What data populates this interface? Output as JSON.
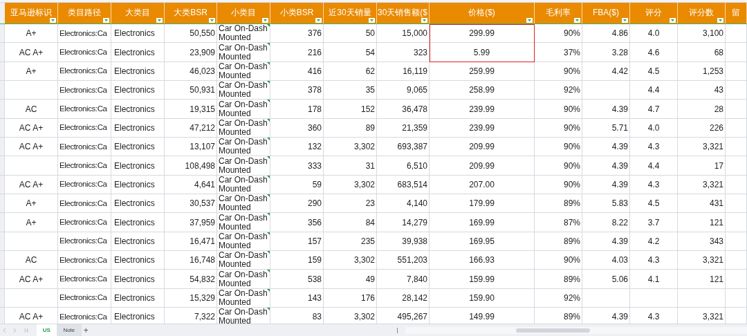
{
  "table": {
    "columns": [
      "亚马逊标识",
      "类目路径",
      "大类目",
      "大类BSR",
      "小类目",
      "小类BSR",
      "近30天销量",
      "30天销售额($",
      "价格($)",
      "毛利率",
      "FBA($)",
      "评分",
      "评分数",
      "留"
    ],
    "rows": [
      {
        "cells": [
          "A+",
          "Electronics:Ca",
          "Electronics",
          "50,550",
          "Car On-Dash Mounted",
          "376",
          "50",
          "15,000",
          "299.99",
          "90%",
          "4.86",
          "4.0",
          "3,100"
        ],
        "note_marker": true,
        "price_highlighted": true
      },
      {
        "cells": [
          "AC A+",
          "Electronics:Ca",
          "Electronics",
          "23,909",
          "Car On-Dash Mounted",
          "216",
          "54",
          "323",
          "5.99",
          "37%",
          "3.28",
          "4.6",
          "68"
        ],
        "note_marker": true,
        "price_highlighted": true
      },
      {
        "cells": [
          "A+",
          "Electronics:Ca",
          "Electronics",
          "46,023",
          "Car On-Dash Mounted",
          "416",
          "62",
          "16,119",
          "259.99",
          "90%",
          "4.42",
          "4.5",
          "1,253"
        ],
        "note_marker": true,
        "price_highlighted": false
      },
      {
        "cells": [
          "",
          "Electronics:Ca",
          "Electronics",
          "50,931",
          "Car On-Dash Mounted",
          "378",
          "35",
          "9,065",
          "258.99",
          "92%",
          "",
          "4.4",
          "43"
        ],
        "note_marker": true,
        "price_highlighted": false
      },
      {
        "cells": [
          "AC",
          "Electronics:Ca",
          "Electronics",
          "19,315",
          "Car On-Dash Mounted",
          "178",
          "152",
          "36,478",
          "239.99",
          "90%",
          "4.39",
          "4.7",
          "28"
        ],
        "note_marker": true,
        "price_highlighted": false
      },
      {
        "cells": [
          "AC A+",
          "Electronics:Ca",
          "Electronics",
          "47,212",
          "Car On-Dash Mounted",
          "360",
          "89",
          "21,359",
          "239.99",
          "90%",
          "5.71",
          "4.0",
          "226"
        ],
        "note_marker": true,
        "price_highlighted": false
      },
      {
        "cells": [
          "AC A+",
          "Electronics:Ca",
          "Electronics",
          "13,107",
          "Car On-Dash Mounted",
          "132",
          "3,302",
          "693,387",
          "209.99",
          "90%",
          "4.39",
          "4.3",
          "3,321"
        ],
        "note_marker": true,
        "price_highlighted": false
      },
      {
        "cells": [
          "",
          "Electronics:Ca",
          "Electronics",
          "108,498",
          "Car On-Dash Mounted",
          "333",
          "31",
          "6,510",
          "209.99",
          "90%",
          "4.39",
          "4.4",
          "17"
        ],
        "note_marker": true,
        "price_highlighted": false
      },
      {
        "cells": [
          "AC A+",
          "Electronics:Ca",
          "Electronics",
          "4,641",
          "Car On-Dash Mounted",
          "59",
          "3,302",
          "683,514",
          "207.00",
          "90%",
          "4.39",
          "4.3",
          "3,321"
        ],
        "note_marker": true,
        "price_highlighted": false
      },
      {
        "cells": [
          "A+",
          "Electronics:Ca",
          "Electronics",
          "30,537",
          "Car On-Dash Mounted",
          "290",
          "23",
          "4,140",
          "179.99",
          "89%",
          "5.83",
          "4.5",
          "431"
        ],
        "note_marker": true,
        "price_highlighted": false
      },
      {
        "cells": [
          "A+",
          "Electronics:Ca",
          "Electronics",
          "37,959",
          "Car On-Dash Mounted",
          "356",
          "84",
          "14,279",
          "169.99",
          "87%",
          "8.22",
          "3.7",
          "121"
        ],
        "note_marker": true,
        "price_highlighted": false
      },
      {
        "cells": [
          "",
          "Electronics:Ca",
          "Electronics",
          "16,471",
          "Car On-Dash Mounted",
          "157",
          "235",
          "39,938",
          "169.95",
          "89%",
          "4.39",
          "4.2",
          "343"
        ],
        "note_marker": true,
        "price_highlighted": false
      },
      {
        "cells": [
          "AC",
          "Electronics:Ca",
          "Electronics",
          "16,748",
          "Car On-Dash Mounted",
          "159",
          "3,302",
          "551,203",
          "166.93",
          "90%",
          "4.03",
          "4.3",
          "3,321"
        ],
        "note_marker": true,
        "price_highlighted": false
      },
      {
        "cells": [
          "AC A+",
          "Electronics:Ca",
          "Electronics",
          "54,832",
          "Car On-Dash Mounted",
          "538",
          "49",
          "7,840",
          "159.99",
          "89%",
          "5.06",
          "4.1",
          "121"
        ],
        "note_marker": true,
        "price_highlighted": false
      },
      {
        "cells": [
          "",
          "Electronics:Ca",
          "Electronics",
          "15,329",
          "Car On-Dash Mounted",
          "143",
          "176",
          "28,142",
          "159.90",
          "92%",
          "",
          "",
          ""
        ],
        "note_marker": true,
        "price_highlighted": false
      },
      {
        "cells": [
          "AC A+",
          "Electronics:Ca",
          "Electronics",
          "7,322",
          "Car On-Dash Mounted",
          "83",
          "3,302",
          "495,267",
          "149.99",
          "89%",
          "4.39",
          "4.3",
          "3,321"
        ],
        "note_marker": true,
        "price_highlighted": false
      }
    ]
  },
  "sheet_tabs": [
    {
      "label": "US",
      "selected": true
    },
    {
      "label": "Note",
      "selected": false
    }
  ],
  "add_sheet": "+"
}
